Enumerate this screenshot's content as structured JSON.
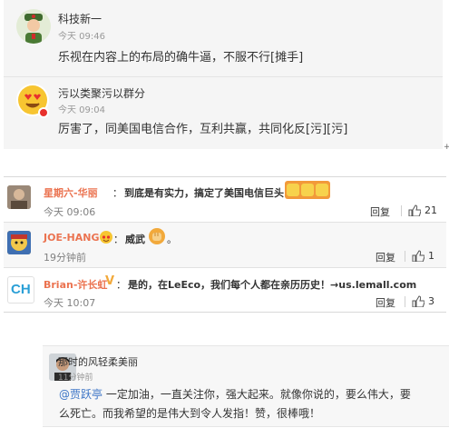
{
  "panel1": {
    "comments": [
      {
        "name": "科技新一",
        "time": "今天 09:46",
        "text": "乐视在内容上的布局的确牛逼，不服不行[摊手]",
        "avatar": "soldier-avatar-icon"
      },
      {
        "name": "污以类聚污以群分",
        "time": "今天 09:04",
        "text": "厉害了，同美国电信合作，互利共赢，共同化反[污][污]",
        "avatar": "heart-eyes-emoji-avatar-icon"
      }
    ]
  },
  "panel2": {
    "reply_label": "回复",
    "comments": [
      {
        "name": "星期六-华丽",
        "colon": "：",
        "text": "到底是有实力，搞定了美国电信巨头",
        "time": "今天 09:06",
        "likes": "21"
      },
      {
        "name": "JOE-HANG",
        "colon": "：",
        "text": "威武",
        "time": "19分钟前",
        "likes": "1"
      },
      {
        "name": "Brian-许长虹",
        "colon": "：",
        "text": "是的，在LeEco，我们每个人都在亲历历史！→us.lemall.com",
        "time": "今天 10:07",
        "likes": "3",
        "avatar_text": "CH"
      }
    ],
    "colors": {
      "username": "#eb7350",
      "text": "#333333",
      "muted": "#808080"
    }
  },
  "panel3": {
    "name": "那时的风轻柔美丽",
    "time": "11分钟前",
    "mention": "@贾跃亭",
    "text_line1": " 一定加油，一直关注你，强大起来。就像你说的，要么伟大，要",
    "text_line2": "么死亡。而我希望的是伟大到令人发指！赞，很棒哦！"
  }
}
